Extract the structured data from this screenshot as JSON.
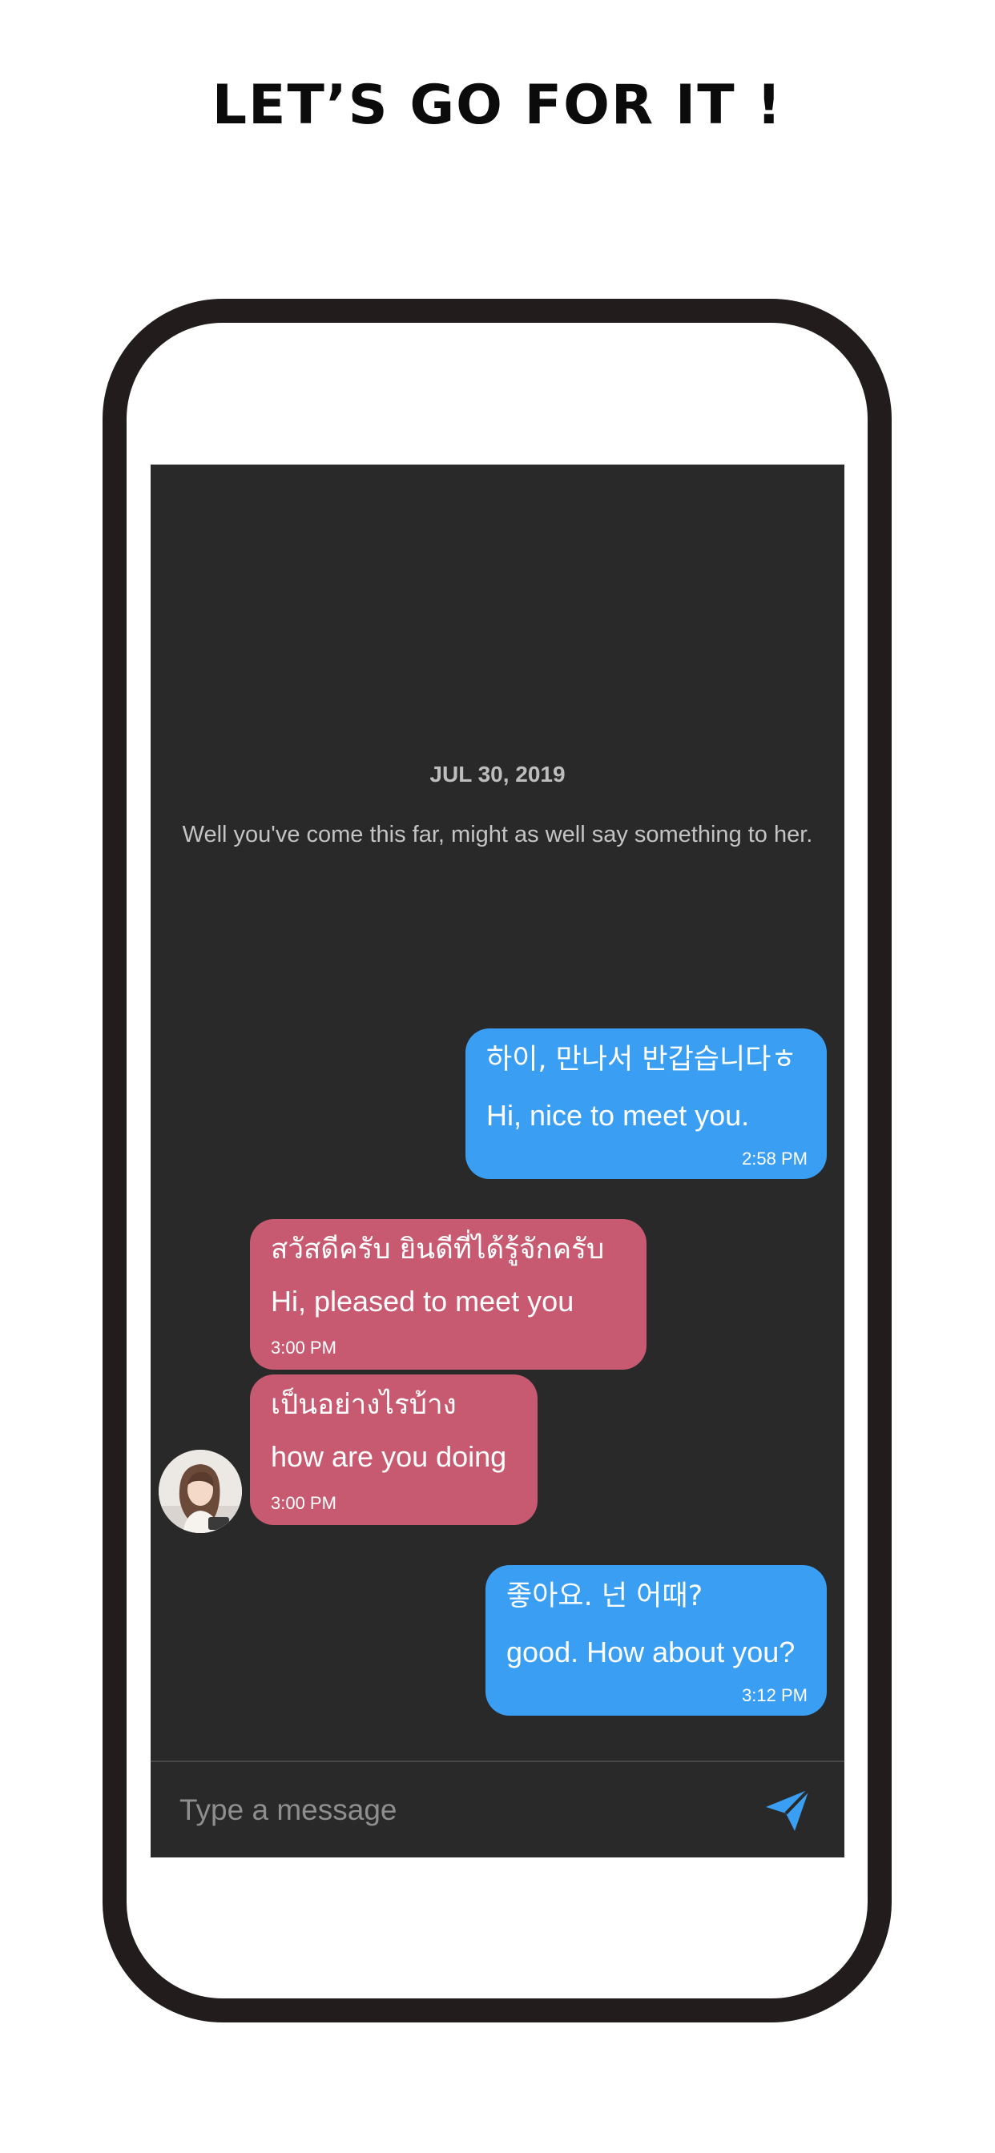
{
  "headline": "LET’S GO FOR IT !",
  "chat": {
    "date": "JUL 30, 2019",
    "hint": "Well you've come this far, might as well say something to her.",
    "messages": [
      {
        "direction": "sent",
        "native": "하이, 만나서 반갑습니다ㅎ",
        "english": "Hi, nice to meet you.",
        "time": "2:58 PM"
      },
      {
        "direction": "received",
        "native": "สวัสดีครับ ยินดีที่ได้รู้จักครับ",
        "english": "Hi, pleased to meet you",
        "time": "3:00 PM"
      },
      {
        "direction": "received",
        "native": "เป็นอย่างไรบ้าง",
        "english": "how are you doing",
        "time": "3:00 PM"
      },
      {
        "direction": "sent",
        "native": "좋아요. 넌 어때?",
        "english": "good. How about you?",
        "time": "3:12 PM"
      }
    ],
    "input_placeholder": "Type a message",
    "icons": {
      "send": "send-icon",
      "avatar": "contact-avatar"
    },
    "colors": {
      "background": "#292929",
      "sent_bubble": "#3a9ff3",
      "received_bubble": "#c75a70",
      "send_icon": "#3a9ff3"
    }
  }
}
